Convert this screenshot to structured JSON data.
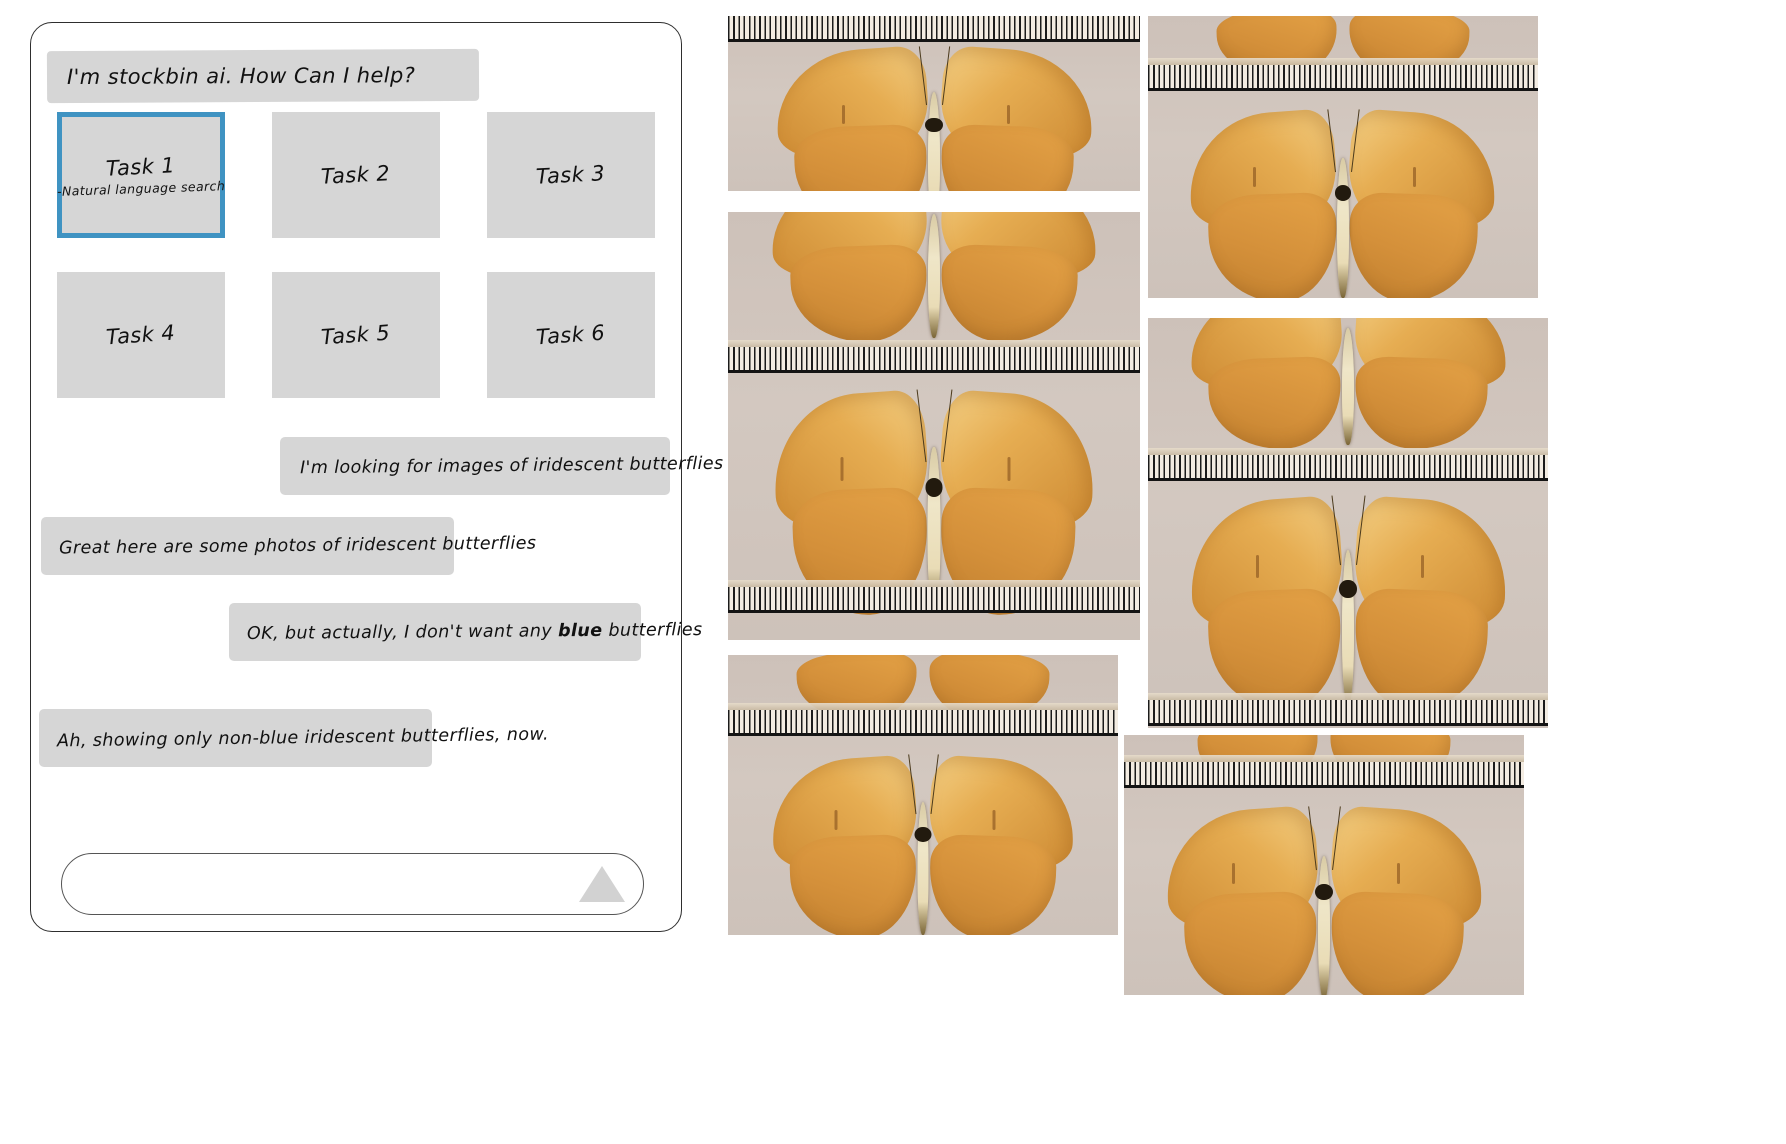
{
  "app": {
    "assistant_greeting": "I'm stockbin ai.  How Can I help?"
  },
  "tasks": [
    {
      "title": "Task 1",
      "subtitle": "-Natural language search",
      "selected": true
    },
    {
      "title": "Task 2",
      "subtitle": "",
      "selected": false
    },
    {
      "title": "Task 3",
      "subtitle": "",
      "selected": false
    },
    {
      "title": "Task 4",
      "subtitle": "",
      "selected": false
    },
    {
      "title": "Task 5",
      "subtitle": "",
      "selected": false
    },
    {
      "title": "Task 6",
      "subtitle": "",
      "selected": false
    }
  ],
  "messages": [
    {
      "role": "user",
      "text": "I'm looking for images of iridescent butterflies"
    },
    {
      "role": "assistant",
      "text": "Great here are some photos of iridescent butterflies"
    },
    {
      "role": "user",
      "text_before": "OK, but actually, I don't want any ",
      "emphasis": "blue",
      "text_after": " butterflies"
    },
    {
      "role": "assistant",
      "text": "Ah, showing only non-blue iridescent butterflies, now."
    }
  ],
  "composer": {
    "value": "",
    "placeholder": "",
    "send_icon": "send-triangle-icon"
  },
  "gallery": {
    "caption": "butterfly specimen photographs with measurement rulers",
    "items": [
      {
        "id": "specimen-1",
        "view": "dorsal-upper",
        "ruler": "top"
      },
      {
        "id": "specimen-2",
        "view": "ventral-lower",
        "ruler": "middle"
      },
      {
        "id": "specimen-3",
        "view": "dorsal-full",
        "ruler": "bottom"
      },
      {
        "id": "specimen-4",
        "view": "wingtips",
        "ruler": "upper"
      },
      {
        "id": "specimen-5",
        "view": "dorsal-full",
        "ruler": "none"
      },
      {
        "id": "specimen-6",
        "view": "ventral-upper",
        "ruler": "lower"
      },
      {
        "id": "specimen-7",
        "view": "dorsal-full",
        "ruler": "bottom"
      },
      {
        "id": "specimen-8",
        "view": "wingtips-ruler",
        "ruler": "upper"
      },
      {
        "id": "specimen-9",
        "view": "dorsal-full",
        "ruler": "none"
      }
    ]
  },
  "colors": {
    "selected_border": "#3f93c2",
    "bubble_bg": "#d6d6d6",
    "card_border": "#2e2e2e",
    "send_icon": "#d2d2d2",
    "plate_bg": "#cfc3bb",
    "wing_orange": "#e2a043"
  }
}
